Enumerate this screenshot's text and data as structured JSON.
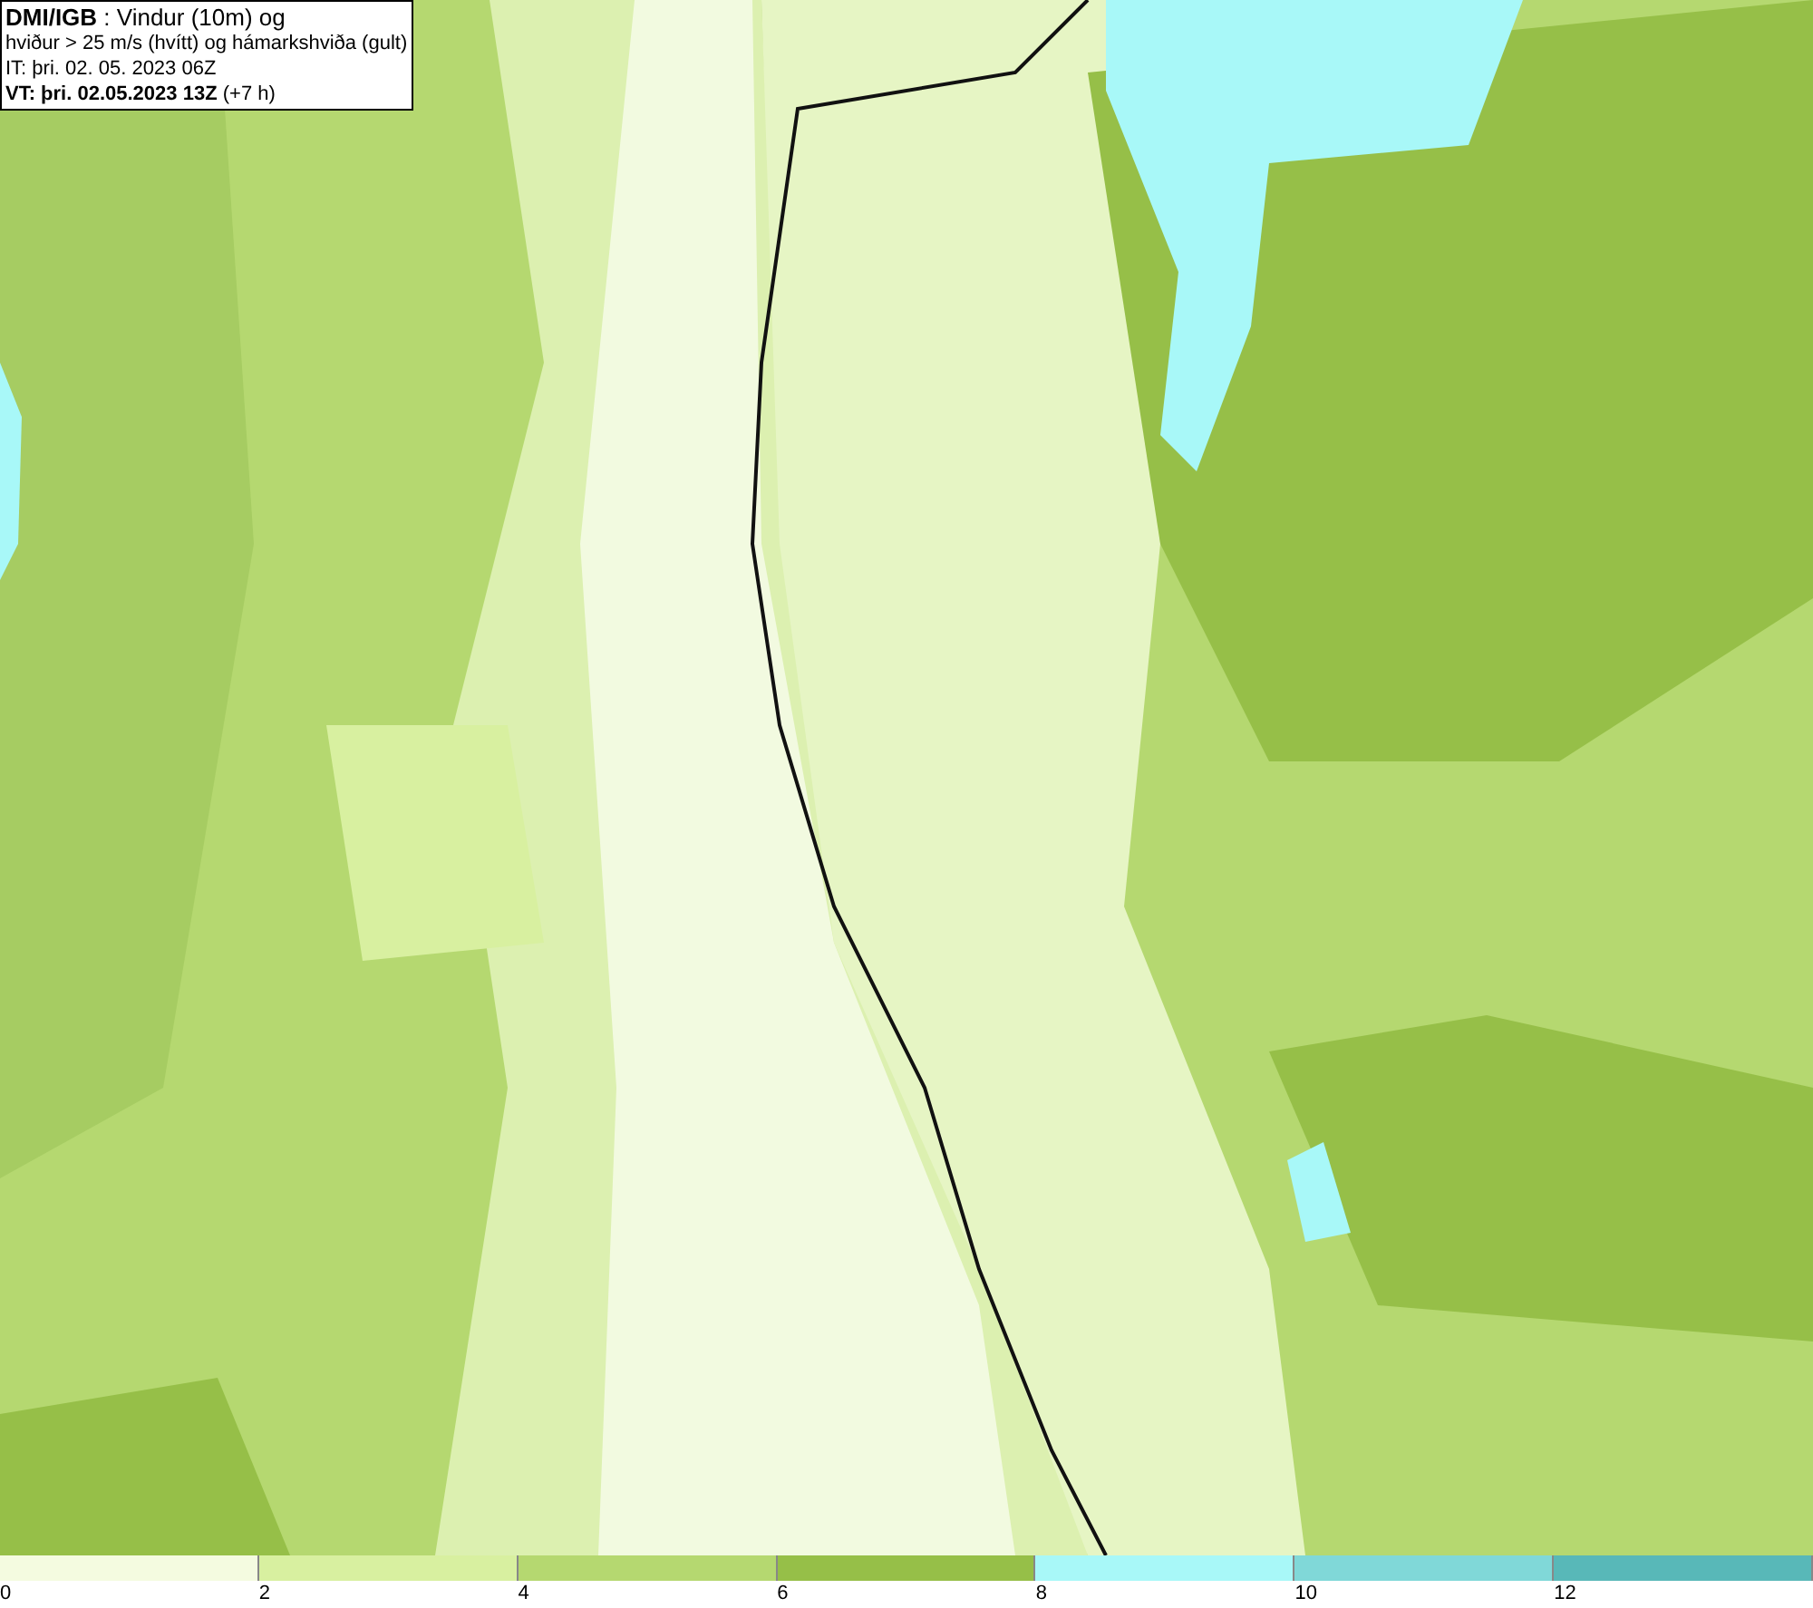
{
  "header": {
    "lines": [
      "**DMI/IGB** : Vindur (10m) og",
      "hviður > 25 m/s (hvítt) og hámarkshviða (gult)",
      "IT: þri. 02. 05. 2023 06Z",
      "**VT: þri. 02.05.2023 13Z** (+7 h)"
    ]
  },
  "scale": {
    "swatches": [
      {
        "color": "#f4fbe0"
      },
      {
        "color": "#d8f0a0"
      },
      {
        "color": "#b5d870"
      },
      {
        "color": "#96bf48"
      },
      {
        "color": "#a8f8f8"
      },
      {
        "color": "#80d8d8"
      },
      {
        "color": "#58b8b8"
      }
    ],
    "ticks": [
      "0",
      "2",
      "4",
      "6",
      "8",
      "10",
      "12"
    ]
  }
}
